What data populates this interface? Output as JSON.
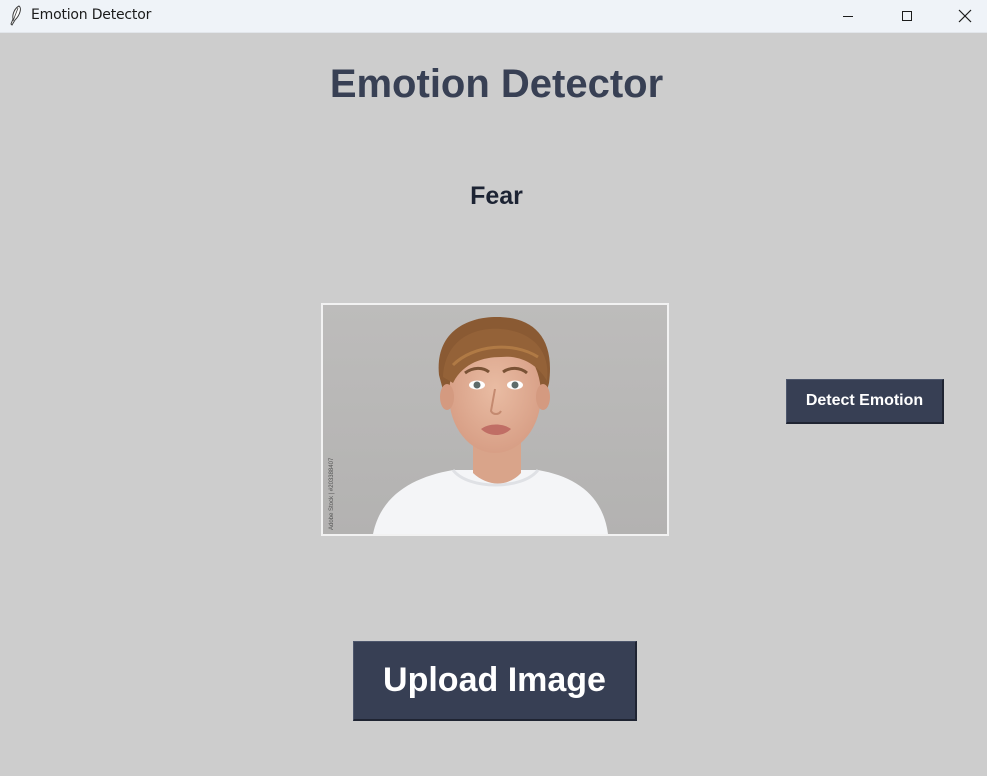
{
  "window": {
    "title": "Emotion Detector",
    "controls": [
      "minimize-icon",
      "maximize-icon",
      "close-icon"
    ]
  },
  "main": {
    "heading": "Emotion Detector",
    "result": "Fear",
    "image_caption": "Adobe Stock | #203388407",
    "detect_button": "Detect Emotion",
    "upload_button": "Upload Image"
  },
  "colors": {
    "background": "#cdcdcd",
    "titlebar": "#eff3f8",
    "heading": "#384054",
    "result": "#1c2333",
    "button_bg": "#373f54",
    "button_text": "#ffffff"
  }
}
